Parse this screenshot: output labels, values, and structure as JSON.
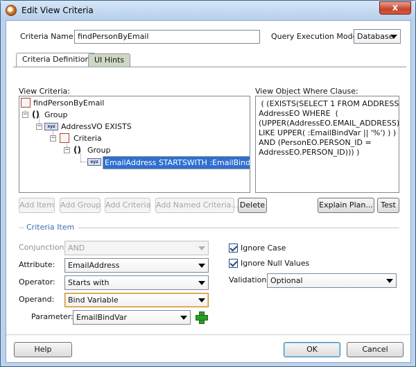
{
  "window": {
    "title": "Edit View Criteria",
    "close_label": "x"
  },
  "criteria_name": {
    "label": "Criteria Name:",
    "value": "findPersonByEmail"
  },
  "query_mode": {
    "label": "Query Execution Mode:",
    "value": "Database"
  },
  "tabs": [
    {
      "label": "Criteria Definition"
    },
    {
      "label": "UI Hints"
    }
  ],
  "view_criteria": {
    "label": "View Criteria:",
    "tree": {
      "root": "findPersonByEmail",
      "group1": "Group",
      "vo": "AddressVO EXISTS",
      "criteria": "Criteria",
      "group2": "Group",
      "item": "EmailAddress STARTSWITH :EmailBindVar",
      "xyz_icon": "xyz"
    }
  },
  "where_clause": {
    "label": "View Object Where Clause:",
    "lines": [
      " ( (EXISTS(SELECT 1 FROM ADDRESS",
      "AddressEO WHERE  (",
      "(UPPER(AddressEO.EMAIL_ADDRESS)",
      "LIKE UPPER( :EmailBindVar || '%') ) )",
      "AND (PersonEO.PERSON_ID =",
      "AddressEO.PERSON_ID))) )"
    ]
  },
  "buttons": {
    "add_item": "Add Item",
    "add_group": "Add Group",
    "add_criteria": "Add Criteria",
    "add_named_criteria": "Add Named Criteria...",
    "delete": "Delete",
    "explain_plan": "Explain Plan...",
    "test": "Test",
    "help": "Help",
    "ok": "OK",
    "cancel": "Cancel"
  },
  "criteria_item": {
    "section_title": "Criteria Item",
    "conjunction": {
      "label": "Conjunction:",
      "value": "AND"
    },
    "attribute": {
      "label": "Attribute:",
      "value": "EmailAddress"
    },
    "operator": {
      "label": "Operator:",
      "value": "Starts with"
    },
    "operand": {
      "label": "Operand:",
      "value": "Bind Variable"
    },
    "parameter": {
      "label": "Parameter:",
      "value": "EmailBindVar"
    },
    "ignore_case": {
      "label": "Ignore Case",
      "checked": true
    },
    "ignore_null": {
      "label": "Ignore Null Values",
      "checked": true
    },
    "validation": {
      "label": "Validation:",
      "value": "Optional"
    }
  },
  "colors": {
    "selection": "#2f6fcf",
    "section_title": "#3b6fa8",
    "add_icon": "#2e9c2a"
  }
}
